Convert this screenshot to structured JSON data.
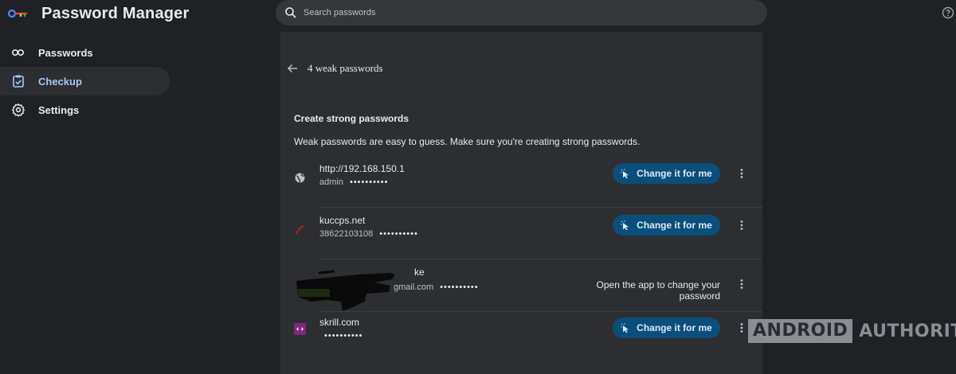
{
  "header": {
    "app_title": "Password Manager",
    "search_placeholder": "Search passwords"
  },
  "sidebar": {
    "items": [
      {
        "label": "Passwords",
        "icon": "key-icon",
        "active": false
      },
      {
        "label": "Checkup",
        "icon": "checkup-icon",
        "active": true
      },
      {
        "label": "Settings",
        "icon": "gear-icon",
        "active": false
      }
    ]
  },
  "main": {
    "back_title": "4 weak passwords",
    "section_title": "Create strong passwords",
    "section_desc": "Weak passwords are easy to guess. Make sure you're creating strong passwords.",
    "entries": [
      {
        "site": "http://192.168.150.1",
        "username": "admin",
        "masked": "••••••••••",
        "action": "Change it for me",
        "icon": "globe-icon"
      },
      {
        "site": "kuccps.net",
        "username": "38622103108",
        "masked": "••••••••••",
        "action": "Change it for me",
        "icon": "kuccps-favicon-icon"
      },
      {
        "site": "ke",
        "username": "gmail.com",
        "masked": "••••••••••",
        "action": "Open the app to change your password",
        "icon": "app-icon"
      },
      {
        "site": "skrill.com",
        "username": "",
        "masked": "••••••••••",
        "action": "Change it for me",
        "icon": "skrill-favicon-icon"
      }
    ]
  },
  "watermark": {
    "boxed": "ANDROID",
    "text": "AUTHORITY"
  },
  "colors": {
    "background": "#202124",
    "panel": "#2d2e31",
    "accent": "#a8c7fa",
    "button": "#0a4f7c"
  }
}
